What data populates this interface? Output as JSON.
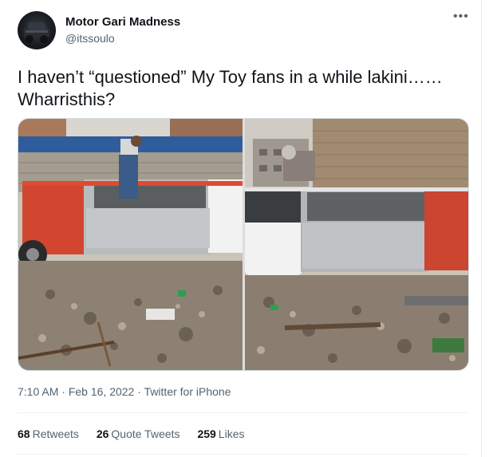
{
  "author": {
    "name": "Motor Gari Madness",
    "handle": "@itssoulo"
  },
  "more_icon": "more-horizontal-icon",
  "tweet": {
    "line1": "I haven’t “questioned” My Toy fans in a while lakini……",
    "line2": "Wharristhis?"
  },
  "meta": {
    "time": "7:10 AM",
    "separator1": " · ",
    "date": "Feb 16, 2022",
    "separator2": " · ",
    "source": "Twitter for iPhone"
  },
  "stats": {
    "retweets_count": "68",
    "retweets_label": "Retweets",
    "quotes_count": "26",
    "quotes_label": "Quote Tweets",
    "likes_count": "259",
    "likes_label": "Likes"
  },
  "colors": {
    "text_primary": "#0f1419",
    "text_secondary": "#536471",
    "border": "#cfd9de",
    "divider": "#eff3f4"
  }
}
